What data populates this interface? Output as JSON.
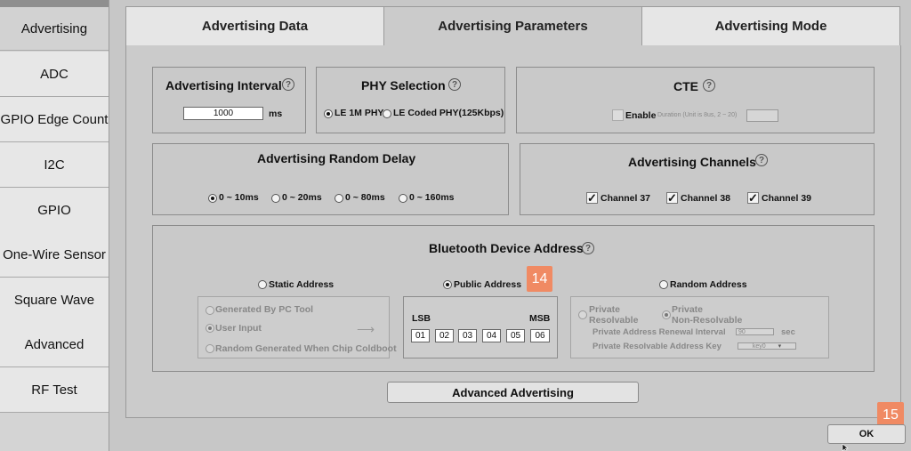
{
  "sidebar": {
    "items": [
      {
        "label": "Advertising"
      },
      {
        "label": "ADC"
      },
      {
        "label": "GPIO Edge Count"
      },
      {
        "label": "I2C"
      },
      {
        "label": "GPIO"
      },
      {
        "label": "One-Wire Sensor"
      },
      {
        "label": "Square Wave"
      },
      {
        "label": "Advanced"
      },
      {
        "label": "RF Test"
      }
    ]
  },
  "tabs": [
    {
      "label": "Advertising Data"
    },
    {
      "label": "Advertising Parameters"
    },
    {
      "label": "Advertising Mode"
    }
  ],
  "adv_interval": {
    "title": "Advertising Interval",
    "value": "1000",
    "unit": "ms"
  },
  "phy": {
    "title": "PHY Selection",
    "options": [
      "LE 1M PHY",
      "LE Coded PHY(125Kbps)"
    ],
    "selected": "LE 1M PHY"
  },
  "cte": {
    "title": "CTE",
    "enable_label": "Enable",
    "duration_label": "Duration (Unit is 8us, 2 ~ 20)",
    "duration_value": ""
  },
  "random_delay": {
    "title": "Advertising Random Delay",
    "options": [
      "0 ~ 10ms",
      "0 ~ 20ms",
      "0 ~ 80ms",
      "0 ~ 160ms"
    ],
    "selected": "0 ~ 10ms"
  },
  "channels": {
    "title": "Advertising Channels",
    "items": [
      {
        "label": "Channel 37",
        "checked": true
      },
      {
        "label": "Channel 38",
        "checked": true
      },
      {
        "label": "Channel 39",
        "checked": true
      }
    ]
  },
  "bda": {
    "title": "Bluetooth Device Address",
    "modes": [
      "Static Address",
      "Public Address",
      "Random Address"
    ],
    "selected": "Public Address",
    "static_options": [
      "Generated By PC Tool",
      "User Input",
      "Random Generated When Chip Coldboot"
    ],
    "lsb_label": "LSB",
    "msb_label": "MSB",
    "bytes": [
      "01",
      "02",
      "03",
      "04",
      "05",
      "06"
    ],
    "random_options": [
      "Private\nResolvable",
      "Private\nNon-Resolvable"
    ],
    "renewal_label": "Private Address Renewal Interval",
    "renewal_value": "90",
    "renewal_unit": "sec",
    "key_label": "Private Resolvable Address Key",
    "key_value": "key0"
  },
  "advanced_button": "Advanced Advertising",
  "ok_button": "OK",
  "badges": [
    "14",
    "15"
  ]
}
